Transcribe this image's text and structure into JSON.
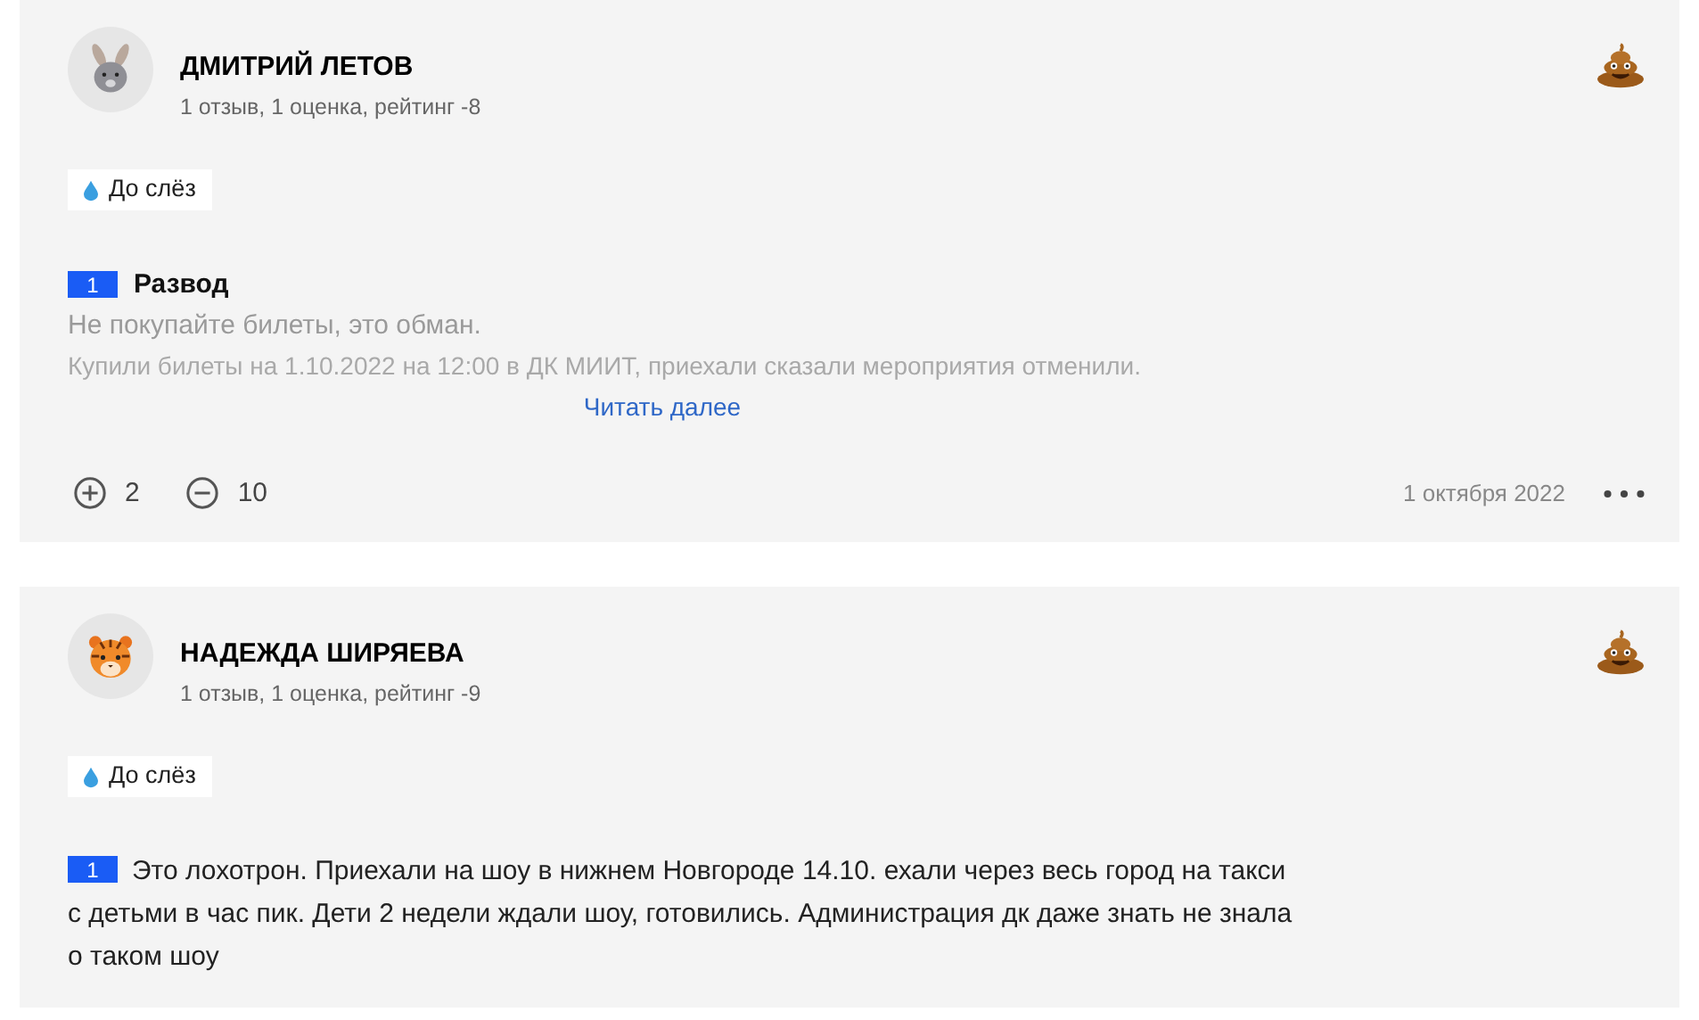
{
  "reviews": [
    {
      "avatar": {
        "kind": "rabbit"
      },
      "name": "ДМИТРИЙ ЛЕТОВ",
      "stats": "1 отзыв, 1 оценка, рейтинг -8",
      "tag": "До слёз",
      "number": "1",
      "title": "Развод",
      "text": "Не покупайте билеты, это обман.",
      "faded_text": "Купили билеты на 1.10.2022 на 12:00 в ДК МИИТ, приехали сказали мероприятия отменили.",
      "read_more": "Читать далее",
      "plus": "2",
      "minus": "10",
      "date": "1 октября 2022"
    },
    {
      "avatar": {
        "kind": "tiger"
      },
      "name": "НАДЕЖДА ШИРЯЕВА",
      "stats": "1 отзыв, 1 оценка, рейтинг -9",
      "tag": "До слёз",
      "number": "1",
      "text": "Это лохотрон. Приехали на шоу в нижнем Новгороде 14.10. ехали через весь город на такси с детьми в час пик. Дети 2 недели ждали шоу, готовились. Администрация дк даже знать не знала о таком шоу"
    }
  ]
}
